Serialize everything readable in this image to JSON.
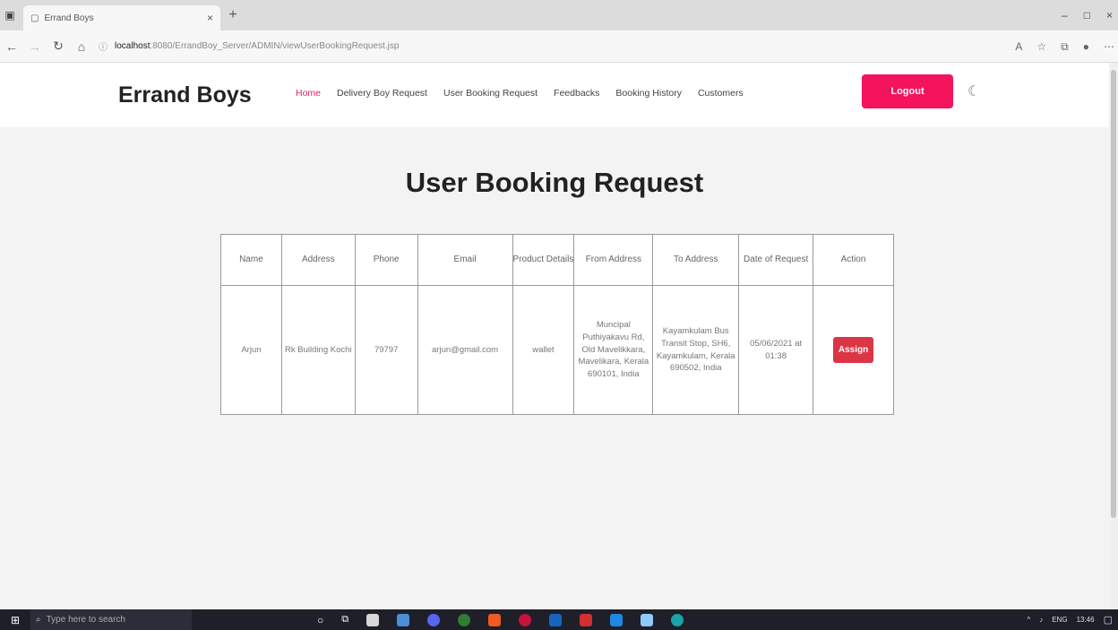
{
  "browser": {
    "tab_title": "Errand Boys",
    "url_host": "localhost",
    "url_path": ":8080/ErrandBoy_Server/ADMIN/viewUserBookingRequest.jsp"
  },
  "header": {
    "brand": "Errand Boys",
    "menu": [
      "Home",
      "Delivery Boy Request",
      "User Booking Request",
      "Feedbacks",
      "Booking History",
      "Customers"
    ],
    "logout_label": "Logout"
  },
  "main": {
    "title": "User Booking Request",
    "columns": [
      "Name",
      "Address",
      "Phone",
      "Email",
      "Product Details",
      "From Address",
      "To Address",
      "Date of Request",
      "Action"
    ],
    "rows": [
      {
        "name": "Arjun",
        "address": "Rk Building Kochi",
        "phone": "79797",
        "email": "arjun@gmail.com",
        "product": "wallet",
        "from": "Muncipal Puthiyakavu Rd, Old Mavelikkara, Mavelikara, Kerala 690101, India",
        "to": "Kayamkulam Bus Transit Stop, SH6, Kayamkulam, Kerala 690502, India",
        "date": "05/06/2021 at 01:38",
        "action_label": "Assign"
      }
    ]
  },
  "taskbar": {
    "search_placeholder": "Type here to search",
    "language": "ENG",
    "time": "13:46"
  },
  "colors": {
    "accent": "#f5135b",
    "assign": "#dc3545",
    "active_menu": "#e91e63"
  }
}
